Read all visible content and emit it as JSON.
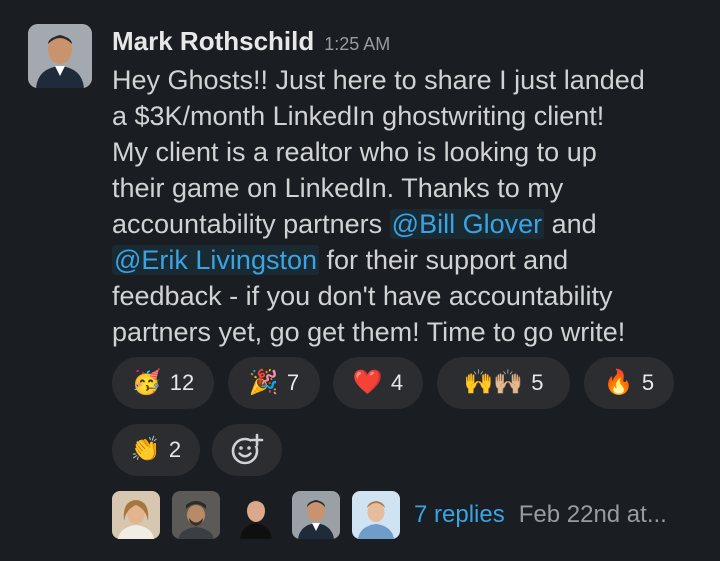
{
  "message": {
    "author": "Mark Rothschild",
    "time": "1:25 AM",
    "lines": [
      {
        "text": "Hey Ghosts!! Just here to share I just landed"
      },
      {
        "text": "a $3K/month LinkedIn ghostwriting client!"
      },
      {
        "text": "My client is a realtor who is looking to up"
      },
      {
        "text": "their game on LinkedIn. Thanks to my"
      },
      {
        "before": "accountability partners ",
        "mention": "@Bill Glover",
        "after": " and"
      },
      {
        "mention": "@Erik Livingston",
        "after": " for their support and"
      },
      {
        "text": "feedback - if you don't have accountability"
      },
      {
        "text": "partners yet, go get them! Time to go write!"
      }
    ]
  },
  "reactions": [
    {
      "emoji": "🥳",
      "icon": "partying-face-icon",
      "count": "12"
    },
    {
      "emoji": "🎉",
      "icon": "party-popper-icon",
      "count": "7"
    },
    {
      "emoji": "❤️",
      "icon": "red-heart-icon",
      "count": "4"
    },
    {
      "emoji": "🙌🙌🏼",
      "icon": "raising-hands-icon",
      "count": "5"
    },
    {
      "emoji": "🔥",
      "icon": "fire-icon",
      "count": "5"
    },
    {
      "emoji": "👏",
      "icon": "clapping-hands-icon",
      "count": "2"
    }
  ],
  "add_reaction_icon": "add-reaction-icon",
  "thread": {
    "replies": "7 replies",
    "date": "Feb 22nd at..."
  },
  "colors": {
    "background": "#1a1d21",
    "mention": "#3aa3e3",
    "pill_bg": "#2b2d31"
  }
}
